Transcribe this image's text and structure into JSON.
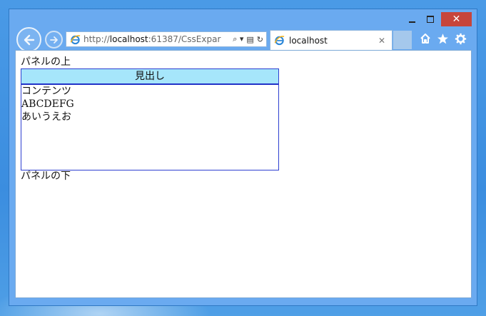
{
  "window": {
    "close_glyph": "✕",
    "controls": {
      "minimize": "minimize-icon",
      "maximize": "maximize-icon",
      "close": "close-icon"
    }
  },
  "navigation": {
    "back_icon": "back-arrow-icon",
    "forward_icon": "forward-arrow-icon"
  },
  "address_bar": {
    "prefix": "http://",
    "host": "localhost",
    "rest": ":61387/CssExpar",
    "search_glyph": "⌕ ▾",
    "compat_glyph": "▤",
    "refresh_glyph": "↻"
  },
  "tab": {
    "title": "localhost",
    "close_glyph": "✕"
  },
  "toolbar": {
    "home_icon": "home-icon",
    "favorites_icon": "star-icon",
    "settings_icon": "gear-icon"
  },
  "page": {
    "above_panel": "パネルの上",
    "panel": {
      "heading": "見出し",
      "lines": [
        "コンテンツ",
        "ABCDEFG",
        "あいうえお"
      ]
    },
    "below_panel": "パネルの下"
  },
  "colors": {
    "panel_header_bg": "#a6e6fb",
    "panel_border": "#2d3fd0",
    "close_button": "#c7453b"
  }
}
